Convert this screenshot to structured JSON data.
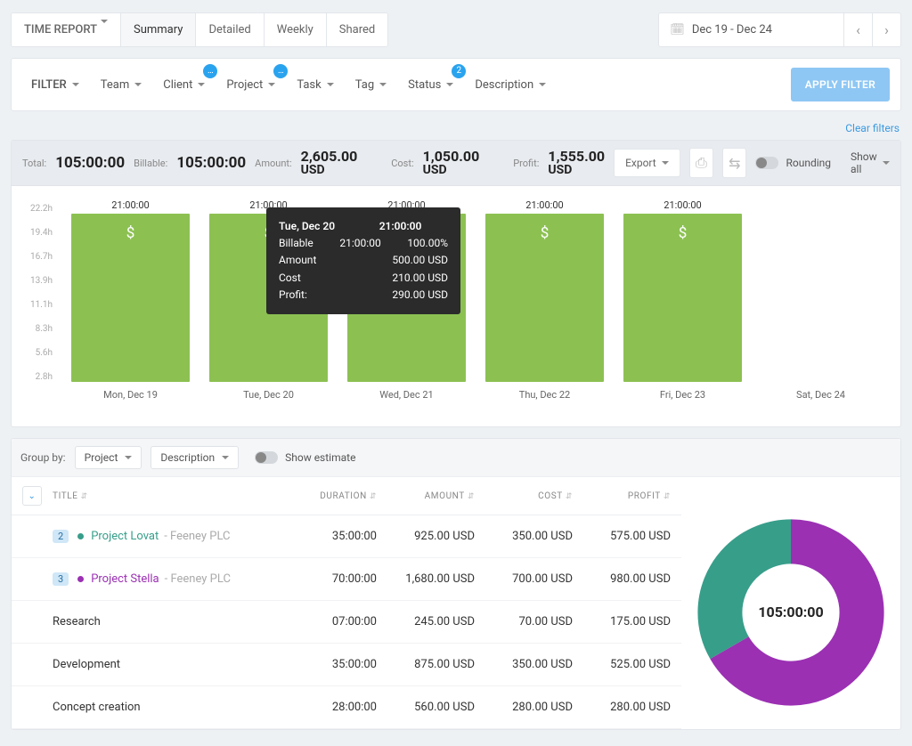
{
  "topbar": {
    "time_report_label": "TIME REPORT",
    "tabs": [
      "Summary",
      "Detailed",
      "Weekly",
      "Shared"
    ],
    "active_tab": "Summary",
    "date_range": "Dec 19 - Dec 24"
  },
  "filters": {
    "filter_label": "FILTER",
    "items": [
      {
        "label": "Team",
        "badge": null
      },
      {
        "label": "Client",
        "badge": "…"
      },
      {
        "label": "Project",
        "badge": "…"
      },
      {
        "label": "Task",
        "badge": null
      },
      {
        "label": "Tag",
        "badge": null
      },
      {
        "label": "Status",
        "badge": "2"
      },
      {
        "label": "Description",
        "badge": null
      }
    ],
    "apply_label": "APPLY FILTER",
    "clear_label": "Clear filters"
  },
  "totals": {
    "total_label": "Total:",
    "total_value": "105:00:00",
    "billable_label": "Billable:",
    "billable_value": "105:00:00",
    "amount_label": "Amount:",
    "amount_value": "2,605.00",
    "amount_unit": "USD",
    "cost_label": "Cost:",
    "cost_value": "1,050.00",
    "cost_unit": "USD",
    "profit_label": "Profit:",
    "profit_value": "1,555.00",
    "profit_unit": "USD",
    "export_label": "Export",
    "rounding_label": "Rounding",
    "showall_label": "Show all"
  },
  "chart_data": {
    "type": "bar",
    "y_ticks": [
      "22.2h",
      "19.4h",
      "16.7h",
      "13.9h",
      "11.1h",
      "8.3h",
      "5.6h",
      "2.8h"
    ],
    "categories": [
      "Mon, Dec 19",
      "Tue, Dec 20",
      "Wed, Dec 21",
      "Thu, Dec 22",
      "Fri, Dec 23",
      "Sat, Dec 24"
    ],
    "values_hours": [
      21,
      21,
      21,
      21,
      21,
      0
    ],
    "labels_top": [
      "21:00:00",
      "21:00:00",
      "21:00:00",
      "21:00:00",
      "21:00:00",
      ""
    ],
    "ylim": [
      0,
      22.2
    ],
    "tooltip": {
      "title": "Tue, Dec 20",
      "title_value": "21:00:00",
      "rows": [
        {
          "label": "Billable",
          "mid": "21:00:00",
          "right": "100.00%"
        },
        {
          "label": "Amount",
          "mid": "",
          "right": "500.00 USD"
        },
        {
          "label": "Cost",
          "mid": "",
          "right": "210.00 USD"
        },
        {
          "label": "Profit:",
          "mid": "",
          "right": "290.00 USD"
        }
      ]
    }
  },
  "groupbar": {
    "label": "Group by:",
    "primary": "Project",
    "secondary": "Description",
    "show_estimate_label": "Show estimate"
  },
  "table": {
    "headers": {
      "title": "TITLE",
      "duration": "DURATION",
      "amount": "AMOUNT",
      "cost": "COST",
      "profit": "PROFIT"
    },
    "rows": [
      {
        "count": "2",
        "dot": "#379e8a",
        "name": "Project Lovat",
        "client": "- Feeney PLC",
        "duration": "35:00:00",
        "amount": "925.00 USD",
        "cost": "350.00 USD",
        "profit": "575.00 USD"
      },
      {
        "count": "3",
        "dot": "#9b30b3",
        "name": "Project Stella",
        "client": "- Feeney PLC",
        "duration": "70:00:00",
        "amount": "1,680.00 USD",
        "cost": "700.00 USD",
        "profit": "980.00 USD"
      },
      {
        "count": null,
        "dot": null,
        "name": "Research",
        "client": "",
        "duration": "07:00:00",
        "amount": "245.00 USD",
        "cost": "70.00 USD",
        "profit": "175.00 USD"
      },
      {
        "count": null,
        "dot": null,
        "name": "Development",
        "client": "",
        "duration": "35:00:00",
        "amount": "875.00 USD",
        "cost": "350.00 USD",
        "profit": "525.00 USD"
      },
      {
        "count": null,
        "dot": null,
        "name": "Concept creation",
        "client": "",
        "duration": "28:00:00",
        "amount": "560.00 USD",
        "cost": "280.00 USD",
        "profit": "280.00 USD"
      }
    ]
  },
  "donut": {
    "center": "105:00:00",
    "series": [
      {
        "name": "Project Lovat",
        "value": 35,
        "color": "#379e8a"
      },
      {
        "name": "Project Stella",
        "value": 70,
        "color": "#9b30b3"
      }
    ]
  }
}
